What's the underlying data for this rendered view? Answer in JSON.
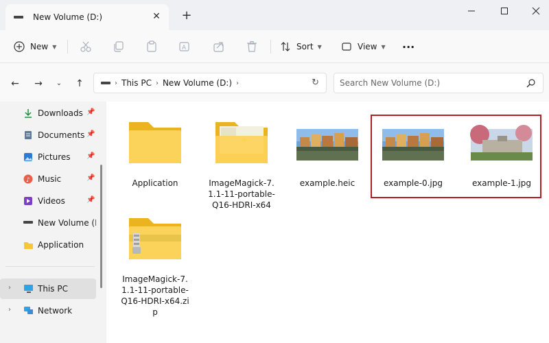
{
  "window": {
    "tab_title": "New Volume (D:)",
    "tab_close": "✕",
    "new_tab": "+"
  },
  "toolbar": {
    "new_label": "New",
    "sort_label": "Sort",
    "view_label": "View",
    "more_label": "···"
  },
  "address": {
    "segments": [
      "This PC",
      "New Volume (D:)"
    ],
    "search_placeholder": "Search New Volume (D:)"
  },
  "sidebar": {
    "quick_access": [
      {
        "label": "Downloads",
        "icon": "download-icon",
        "pinned": true
      },
      {
        "label": "Documents",
        "icon": "documents-icon",
        "pinned": true
      },
      {
        "label": "Pictures",
        "icon": "pictures-icon",
        "pinned": true
      },
      {
        "label": "Music",
        "icon": "music-icon",
        "pinned": true
      },
      {
        "label": "Videos",
        "icon": "videos-icon",
        "pinned": true
      },
      {
        "label": "New Volume (D:",
        "icon": "drive-icon",
        "pinned": false
      },
      {
        "label": "Application",
        "icon": "folder-icon",
        "pinned": false
      }
    ],
    "this_pc": "This PC",
    "network": "Network"
  },
  "files": [
    {
      "name": "Application",
      "type": "folder"
    },
    {
      "name": "ImageMagick-7.1.1-11-portable-Q16-HDRI-x64",
      "type": "folder-open"
    },
    {
      "name": "example.heic",
      "type": "image"
    },
    {
      "name": "example-0.jpg",
      "type": "image"
    },
    {
      "name": "example-1.jpg",
      "type": "image"
    },
    {
      "name": "ImageMagick-7.1.1-11-portable-Q16-HDRI-x64.zip",
      "type": "zip"
    }
  ],
  "colors": {
    "highlight_border": "#b01e23",
    "folder_yellow": "#f8c53a",
    "accent": "#0067c0"
  }
}
